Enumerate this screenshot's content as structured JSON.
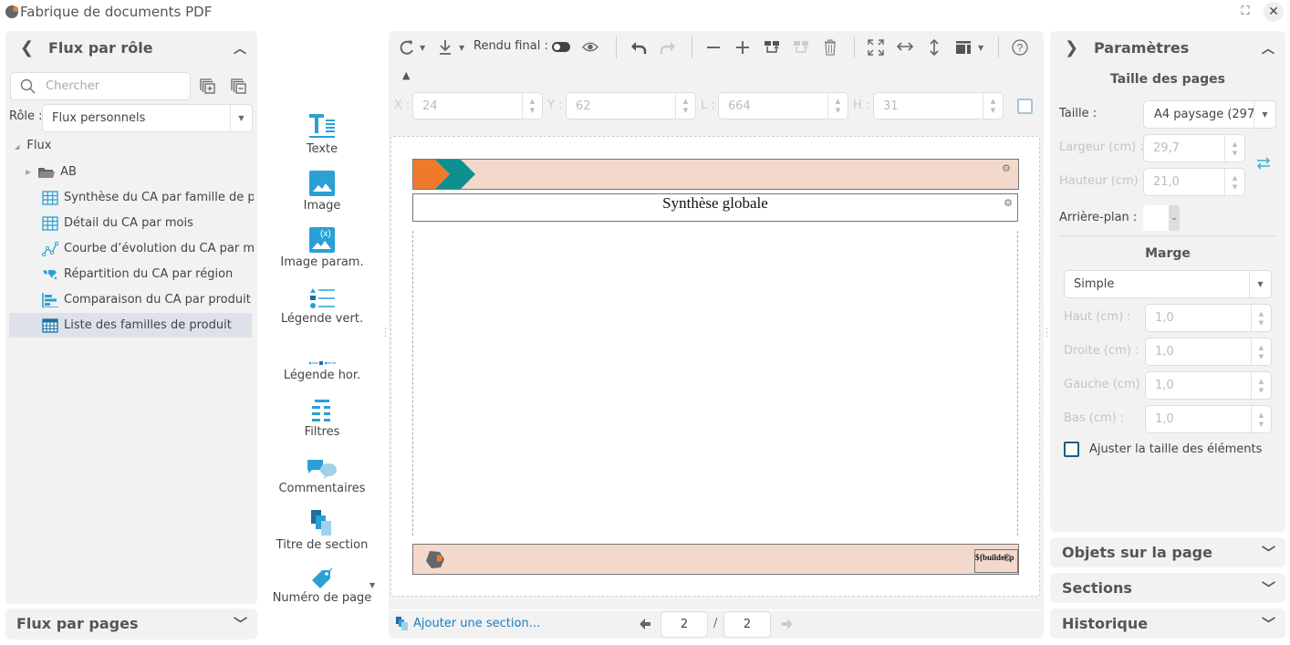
{
  "window": {
    "title": "Fabrique de documents PDF",
    "maximize_icon": "maximize-icon",
    "close_icon": "close-icon"
  },
  "left_panel": {
    "title": "Flux par rôle",
    "search_placeholder": "Chercher",
    "role_label": "Rôle :",
    "role_value": "Flux personnels",
    "tree_root": "Flux",
    "tree_items": [
      {
        "label": "AB",
        "icon": "folder-icon",
        "type": "folder"
      },
      {
        "label": "Synthèse du CA par famille de produit",
        "icon": "table-icon"
      },
      {
        "label": "Détail du CA par mois",
        "icon": "table-icon"
      },
      {
        "label": "Courbe d’évolution du CA par mois",
        "icon": "line-chart-icon"
      },
      {
        "label": "Répartition du CA par région",
        "icon": "map-icon"
      },
      {
        "label": "Comparaison du CA par produit",
        "icon": "bar-chart-icon"
      },
      {
        "label": "Liste des familles de produit",
        "icon": "grid-icon",
        "selected": true
      }
    ],
    "bottom_panel": "Flux par pages"
  },
  "tools": [
    {
      "label": "Texte",
      "icon": "text-icon"
    },
    {
      "label": "Image",
      "icon": "image-icon"
    },
    {
      "label": "Image param.",
      "icon": "image-param-icon"
    },
    {
      "label": "Légende vert.",
      "icon": "vertical-legend-icon"
    },
    {
      "label": "Légende hor.",
      "icon": "horizontal-legend-icon"
    },
    {
      "label": "Filtres",
      "icon": "filters-icon"
    },
    {
      "label": "Commentaires",
      "icon": "comments-icon"
    },
    {
      "label": "Titre de section",
      "icon": "section-title-icon"
    },
    {
      "label": "Numéro de page",
      "icon": "page-number-icon"
    }
  ],
  "toolbar": {
    "render_label": "Rendu final :",
    "coords": {
      "x_label": "X :",
      "x": "24",
      "y_label": "Y :",
      "y": "62",
      "l_label": "L :",
      "l": "664",
      "h_label": "H :",
      "h": "31"
    }
  },
  "canvas": {
    "section_title": "Synthèse globale",
    "footer_field": "${builder.p",
    "header_colors": {
      "orange": "#f07a2c",
      "teal": "#0c9090",
      "band": "#f2d9cb"
    }
  },
  "bottom_bar": {
    "add_section": "Ajouter une section...",
    "current_page": "2",
    "separator": "/",
    "total_pages": "2"
  },
  "right_panel": {
    "title": "Paramètres",
    "page_size_heading": "Taille des pages",
    "size_label": "Taille :",
    "size_value": "A4 paysage (297",
    "width_label": "Largeur (cm) :",
    "width_value": "29,7",
    "height_label": "Hauteur (cm) :",
    "height_value": "21,0",
    "background_label": "Arrière-plan :",
    "margin_heading": "Marge",
    "margin_value": "Simple",
    "top_label": "Haut (cm) :",
    "top_value": "1,0",
    "right_label": "Droite (cm) :",
    "right_value": "1,0",
    "left_label": "Gauche (cm) :",
    "left_value": "1,0",
    "bottom_label": "Bas (cm) :",
    "bottom_value": "1,0",
    "fit_checkbox": "Ajuster la taille des éléments",
    "collapsed": [
      "Objets sur la page",
      "Sections",
      "Historique"
    ]
  }
}
